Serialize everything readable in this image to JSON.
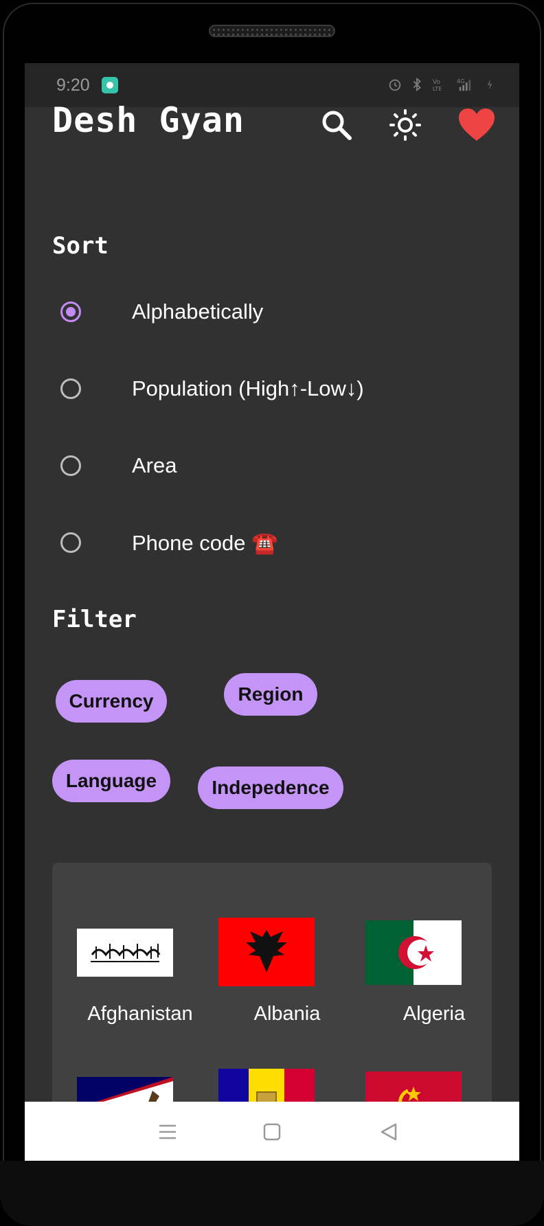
{
  "status_bar": {
    "time": "9:20",
    "icons": [
      "alarm-icon",
      "bluetooth-icon",
      "volte-icon",
      "signal-4g-icon",
      "battery-icon"
    ]
  },
  "app_bar": {
    "title": "Desh Gyan",
    "actions": [
      "search-icon",
      "brightness-icon",
      "favorite-heart-icon"
    ],
    "heart_color": "#ee4444"
  },
  "sort": {
    "title": "Sort",
    "options": [
      {
        "label": "Alphabetically",
        "selected": true
      },
      {
        "label": "Population (High↑-Low↓)",
        "selected": false
      },
      {
        "label": "Area",
        "selected": false
      },
      {
        "label": "Phone code ☎️",
        "selected": false
      }
    ]
  },
  "filter": {
    "title": "Filter",
    "chips": [
      "Currency",
      "Region",
      "Language",
      "Indepedence"
    ]
  },
  "countries": [
    {
      "name": "Afghanistan",
      "flag": "afghanistan-flag"
    },
    {
      "name": "Albania",
      "flag": "albania-flag"
    },
    {
      "name": "Algeria",
      "flag": "algeria-flag"
    },
    {
      "name": "",
      "flag": "american-samoa-flag"
    },
    {
      "name": "",
      "flag": "andorra-flag"
    },
    {
      "name": "",
      "flag": "angola-flag"
    }
  ],
  "nav_bar": {
    "buttons": [
      "menu-icon",
      "home-square-icon",
      "back-triangle-icon"
    ]
  },
  "colors": {
    "background": "#313131",
    "accent": "#c38cf4",
    "chip": "#c495f6",
    "card": "#414141"
  }
}
